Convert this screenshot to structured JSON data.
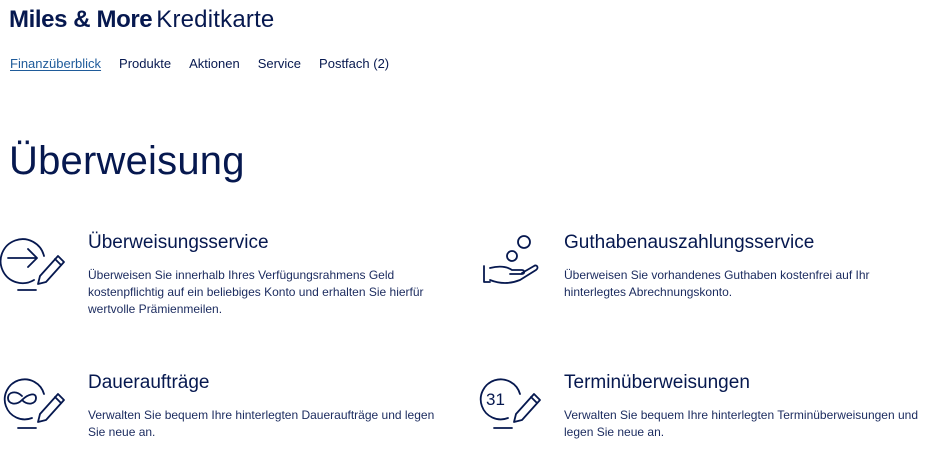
{
  "header": {
    "brand_bold": "Miles & More",
    "brand_light": "Kreditkarte"
  },
  "nav": {
    "items": [
      {
        "label": "Finanzüberblick",
        "active": true
      },
      {
        "label": "Produkte"
      },
      {
        "label": "Aktionen"
      },
      {
        "label": "Service"
      },
      {
        "label": "Postfach (2)"
      }
    ]
  },
  "main": {
    "title": "Überweisung",
    "services": [
      {
        "title": "Überweisungsservice",
        "description": "Überweisen Sie innerhalb Ihres Verfügungsrahmens Geld kostenpflichtig auf ein beliebiges Konto und erhalten Sie hierfür wertvolle Prämienmeilen.",
        "icon": "transfer-arrow-pen-icon"
      },
      {
        "title": "Guthabenauszahlungsservice",
        "description": "Überweisen Sie vorhandenes Guthaben kostenfrei auf Ihr hinterlegtes Abrechnungskonto.",
        "icon": "hand-coins-icon"
      },
      {
        "title": "Daueraufträge",
        "description": "Verwalten Sie bequem Ihre hinterlegten Daueraufträge und legen Sie neue an.",
        "icon": "infinity-pen-icon"
      },
      {
        "title": "Terminüberweisungen",
        "description": "Verwalten Sie bequem Ihre hinterlegten Terminüberweisungen und legen Sie neue an.",
        "icon": "calendar-31-pen-icon",
        "icon_text": "31"
      }
    ]
  },
  "colors": {
    "primary": "#06184f",
    "link_active": "#1f5b9a",
    "background": "#ffffff"
  }
}
